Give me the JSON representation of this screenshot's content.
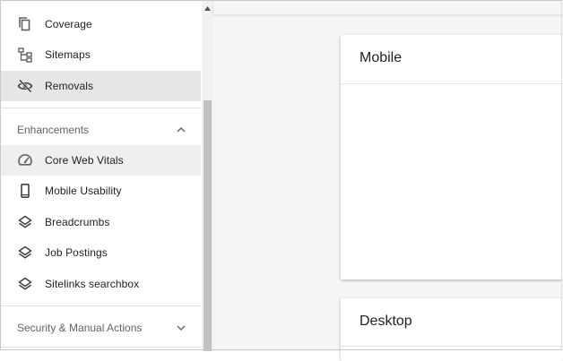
{
  "sidebar": {
    "items_top": [
      {
        "label": "Coverage",
        "icon": "coverage-icon"
      },
      {
        "label": "Sitemaps",
        "icon": "sitemaps-icon"
      },
      {
        "label": "Removals",
        "icon": "removals-eye-off-icon"
      }
    ],
    "enhancements": {
      "header": "Enhancements",
      "items": [
        {
          "label": "Core Web Vitals",
          "icon": "speedometer-icon"
        },
        {
          "label": "Mobile Usability",
          "icon": "mobile-phone-icon"
        },
        {
          "label": "Breadcrumbs",
          "icon": "layers-icon"
        },
        {
          "label": "Job Postings",
          "icon": "layers-icon"
        },
        {
          "label": "Sitelinks searchbox",
          "icon": "layers-icon"
        }
      ]
    },
    "security": {
      "header": "Security & Manual Actions"
    }
  },
  "main": {
    "cards": [
      {
        "title": "Mobile"
      },
      {
        "title": "Desktop"
      }
    ]
  },
  "colors": {
    "active_bg": "#e6e6e6",
    "hover_bg": "#efefef",
    "text": "#202124",
    "muted": "#5f6368",
    "main_bg": "#f5f5f5"
  }
}
